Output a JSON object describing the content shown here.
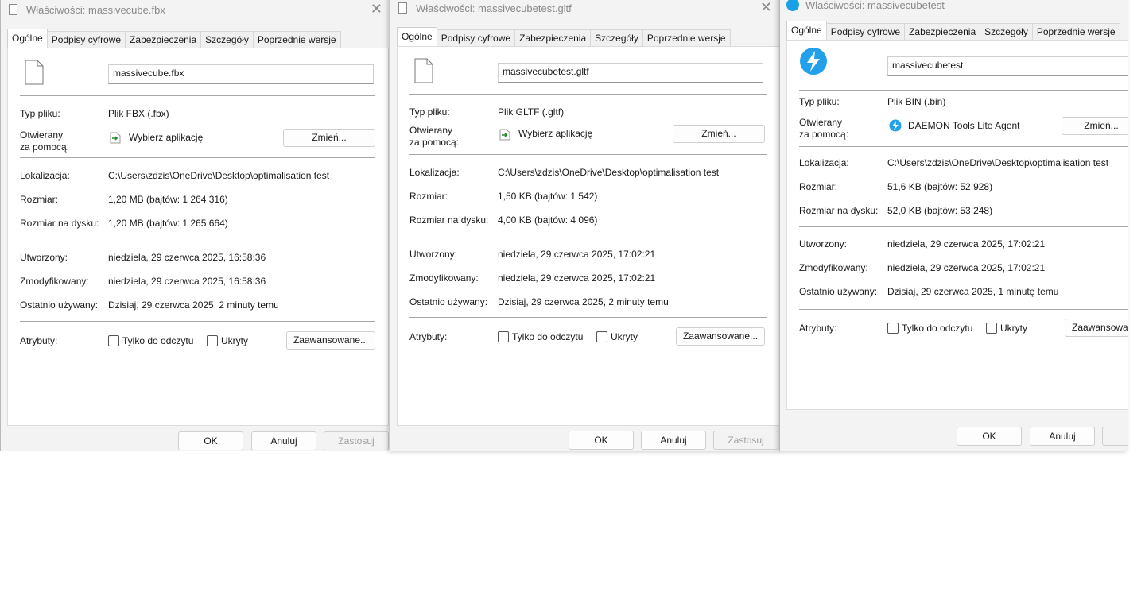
{
  "tabs": [
    "Ogólne",
    "Podpisy cyfrowe",
    "Zabezpieczenia",
    "Szczegóły",
    "Poprzednie wersje"
  ],
  "labels": {
    "type": "Typ pliku:",
    "opens_with_1": "Otwierany",
    "opens_with_2": "za pomocą:",
    "location": "Lokalizacja:",
    "size": "Rozmiar:",
    "size_on_disk": "Rozmiar na dysku:",
    "created": "Utworzony:",
    "modified": "Zmodyfikowany:",
    "accessed": "Ostatnio używany:",
    "attributes": "Atrybuty:"
  },
  "buttons": {
    "change": "Zmień...",
    "readonly": "Tylko do odczytu",
    "hidden": "Ukryty",
    "advanced": "Zaawansowane...",
    "ok": "OK",
    "cancel": "Anuluj",
    "apply": "Zastosuj"
  },
  "dialogs": [
    {
      "title": "Właściwości: massivecube.fbx",
      "filename": "massivecube.fbx",
      "type": "Plik FBX (.fbx)",
      "opens_with": "Wybierz aplikację",
      "location": "C:\\Users\\zdzis\\OneDrive\\Desktop\\optimalisation test",
      "size": "1,20 MB (bajtów: 1 264 316)",
      "size_on_disk": "1,20 MB (bajtów: 1 265 664)",
      "created": "niedziela, 29 czerwca 2025, 16:58:36",
      "modified": "niedziela, 29 czerwca 2025, 16:58:36",
      "accessed": "Dzisiaj, 29 czerwca 2025, 2 minuty temu"
    },
    {
      "title": "Właściwości: massivecubetest.gltf",
      "filename": "massivecubetest.gltf",
      "type": "Plik GLTF (.gltf)",
      "opens_with": "Wybierz aplikację",
      "location": "C:\\Users\\zdzis\\OneDrive\\Desktop\\optimalisation test",
      "size": "1,50 KB (bajtów: 1 542)",
      "size_on_disk": "4,00 KB (bajtów: 4 096)",
      "created": "niedziela, 29 czerwca 2025, 17:02:21",
      "modified": "niedziela, 29 czerwca 2025, 17:02:21",
      "accessed": "Dzisiaj, 29 czerwca 2025, 2 minuty temu"
    },
    {
      "title": "Właściwości: massivecubetest",
      "filename": "massivecubetest",
      "type": "Plik BIN (.bin)",
      "opens_with": "DAEMON Tools Lite Agent",
      "location": "C:\\Users\\zdzis\\OneDrive\\Desktop\\optimalisation test",
      "size": "51,6 KB (bajtów: 52 928)",
      "size_on_disk": "52,0 KB (bajtów: 53 248)",
      "created": "niedziela, 29 czerwca 2025, 17:02:21",
      "modified": "niedziela, 29 czerwca 2025, 17:02:21",
      "accessed": "Dzisiaj, 29 czerwca 2025, 1 minutę temu",
      "apply_partial": "Za",
      "advanced_partial": "Zaawansowa"
    }
  ]
}
